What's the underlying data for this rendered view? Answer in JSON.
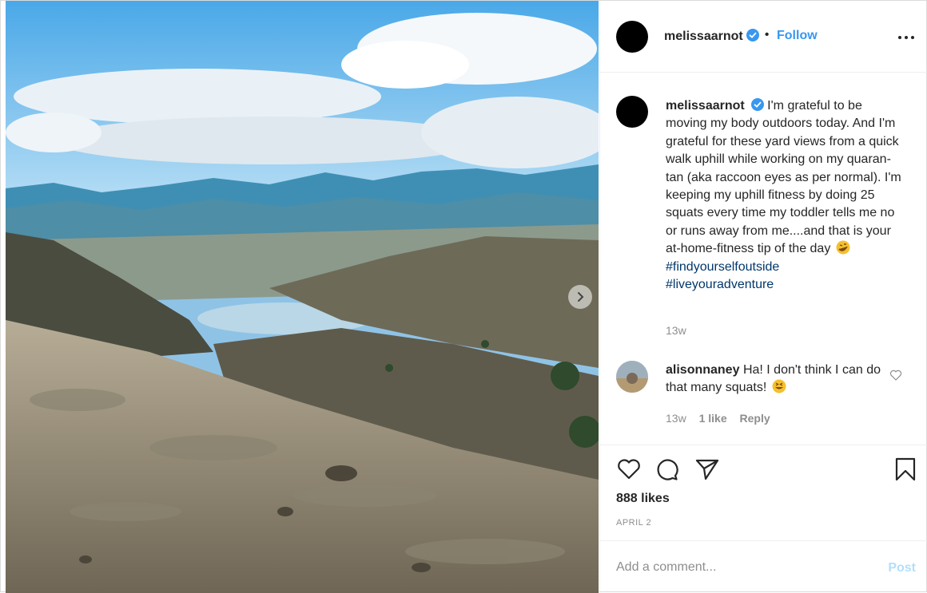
{
  "post": {
    "username": "melissaarnot",
    "verified": true,
    "separator": "•",
    "follow_label": "Follow",
    "more_icon": "more-horizontal-icon",
    "caption": {
      "username": "melissaarnot",
      "text": "I'm grateful to be moving my body outdoors today. And I'm grateful for these yard views from a quick walk uphill while working on my quaran-tan (aka raccoon eyes as per normal). I'm keeping my uphill fitness by doing 25 squats every time my toddler tells me no or runs away from me....and that is your at-home-fitness tip of the day",
      "emoji": "rofl-emoji",
      "hashtags": [
        "#findyourselfoutside",
        "#liveyouradventure"
      ],
      "time": "13w"
    },
    "reply": {
      "username": "alisonnaney",
      "text": "Ha! I don't think I can do that many squats!",
      "emoji": "grinning-squint-emoji",
      "time": "13w",
      "likes": "1 like",
      "reply_label": "Reply"
    },
    "likes": "888 likes",
    "date": "APRIL 2",
    "comment_placeholder": "Add a comment...",
    "post_label": "Post"
  },
  "colors": {
    "link_blue": "#3897f0",
    "hashtag": "#00376b",
    "muted": "#8e8e8e",
    "post_disabled": "#b2dffc",
    "verified_blue": "#3897f0"
  }
}
